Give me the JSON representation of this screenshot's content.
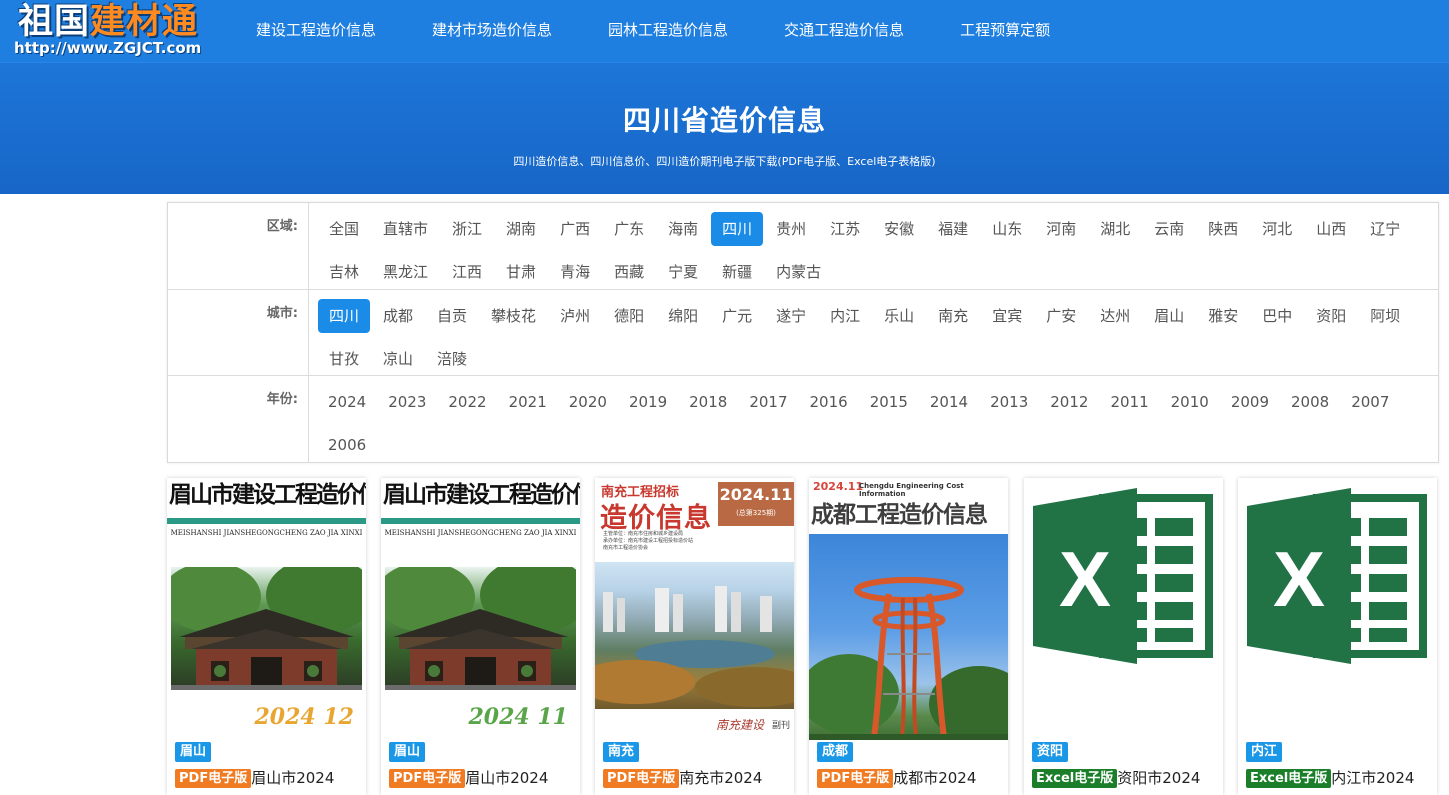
{
  "header": {
    "logo_text_a": "祖国",
    "logo_text_b": "建材通",
    "logo_url": "http://www.ZGJCT.com",
    "nav": [
      {
        "label": "建设工程造价信息"
      },
      {
        "label": "建材市场造价信息"
      },
      {
        "label": "园林工程造价信息"
      },
      {
        "label": "交通工程造价信息"
      },
      {
        "label": "工程预算定额"
      }
    ]
  },
  "banner": {
    "title": "四川省造价信息",
    "subtitle": "四川造价信息、四川信息价、四川造价期刊电子版下载(PDF电子版、Excel电子表格版)"
  },
  "filters": {
    "region": {
      "label": "区域:",
      "selected": "四川",
      "options": [
        "全国",
        "直辖市",
        "浙江",
        "湖南",
        "广西",
        "广东",
        "海南",
        "四川",
        "贵州",
        "江苏",
        "安徽",
        "福建",
        "山东",
        "河南",
        "湖北",
        "云南",
        "陕西",
        "河北",
        "山西",
        "辽宁",
        "吉林",
        "黑龙江",
        "江西",
        "甘肃",
        "青海",
        "西藏",
        "宁夏",
        "新疆",
        "内蒙古"
      ]
    },
    "city": {
      "label": "城市:",
      "selected": "四川",
      "options": [
        "四川",
        "成都",
        "自贡",
        "攀枝花",
        "泸州",
        "德阳",
        "绵阳",
        "广元",
        "遂宁",
        "内江",
        "乐山",
        "南充",
        "宜宾",
        "广安",
        "达州",
        "眉山",
        "雅安",
        "巴中",
        "资阳",
        "阿坝",
        "甘孜",
        "凉山",
        "涪陵"
      ]
    },
    "year": {
      "label": "年份:",
      "options": [
        "2024",
        "2023",
        "2022",
        "2021",
        "2020",
        "2019",
        "2018",
        "2017",
        "2016",
        "2015",
        "2014",
        "2013",
        "2012",
        "2011",
        "2010",
        "2009",
        "2008",
        "2007",
        "2006"
      ]
    }
  },
  "cards": [
    {
      "cover": "meishan",
      "cover_title": "眉山市建设工程造价信息",
      "cover_pinyin": "MEISHANSHI JIANSHEGONGCHENG ZAO JIA XINXI",
      "cover_issue": "2024 12",
      "city": "眉山",
      "type": "PDF电子版",
      "type_kind": "pdf",
      "name": "眉山市2024"
    },
    {
      "cover": "meishan",
      "cover_title": "眉山市建设工程造价信息",
      "cover_pinyin": "MEISHANSHI JIANSHEGONGCHENG ZAO JIA XINXI",
      "cover_issue": "2024 11",
      "city": "眉山",
      "type": "PDF电子版",
      "type_kind": "pdf",
      "name": "眉山市2024"
    },
    {
      "cover": "nanchong",
      "cover_name": "南充工程招标",
      "cover_title": "造价信息",
      "cover_date": "2024.11",
      "cover_no": "(总第325期)",
      "cover_info": [
        "主管单位：南充市住房和城乡建设局",
        "承办单位：南充市建设工程招投标造价站",
        "南充市工程造价协会"
      ],
      "cover_foot": "南充建设",
      "cover_foot2": "副刊",
      "city": "南充",
      "type": "PDF电子版",
      "type_kind": "pdf",
      "name": "南充市2024"
    },
    {
      "cover": "chengdu",
      "cover_date": "2024.11",
      "cover_en": "Chengdu Engineering Cost Information",
      "cover_title": "成都工程造价信息",
      "city": "成都",
      "type": "PDF电子版",
      "type_kind": "pdf",
      "name": "成都市2024"
    },
    {
      "cover": "excel",
      "city": "资阳",
      "type": "Excel电子版",
      "type_kind": "excel",
      "name": "资阳市2024"
    },
    {
      "cover": "excel",
      "city": "内江",
      "type": "Excel电子版",
      "type_kind": "excel",
      "name": "内江市2024"
    }
  ],
  "colors": {
    "header_bg": "#1f7fe0",
    "banner_bg": "#1766c7",
    "active_option": "#1a8be6",
    "pdf_tag": "#f07b22",
    "excel_tag": "#1b7f2a",
    "city_tag": "#1a97e6",
    "excel_icon": "#217346"
  }
}
